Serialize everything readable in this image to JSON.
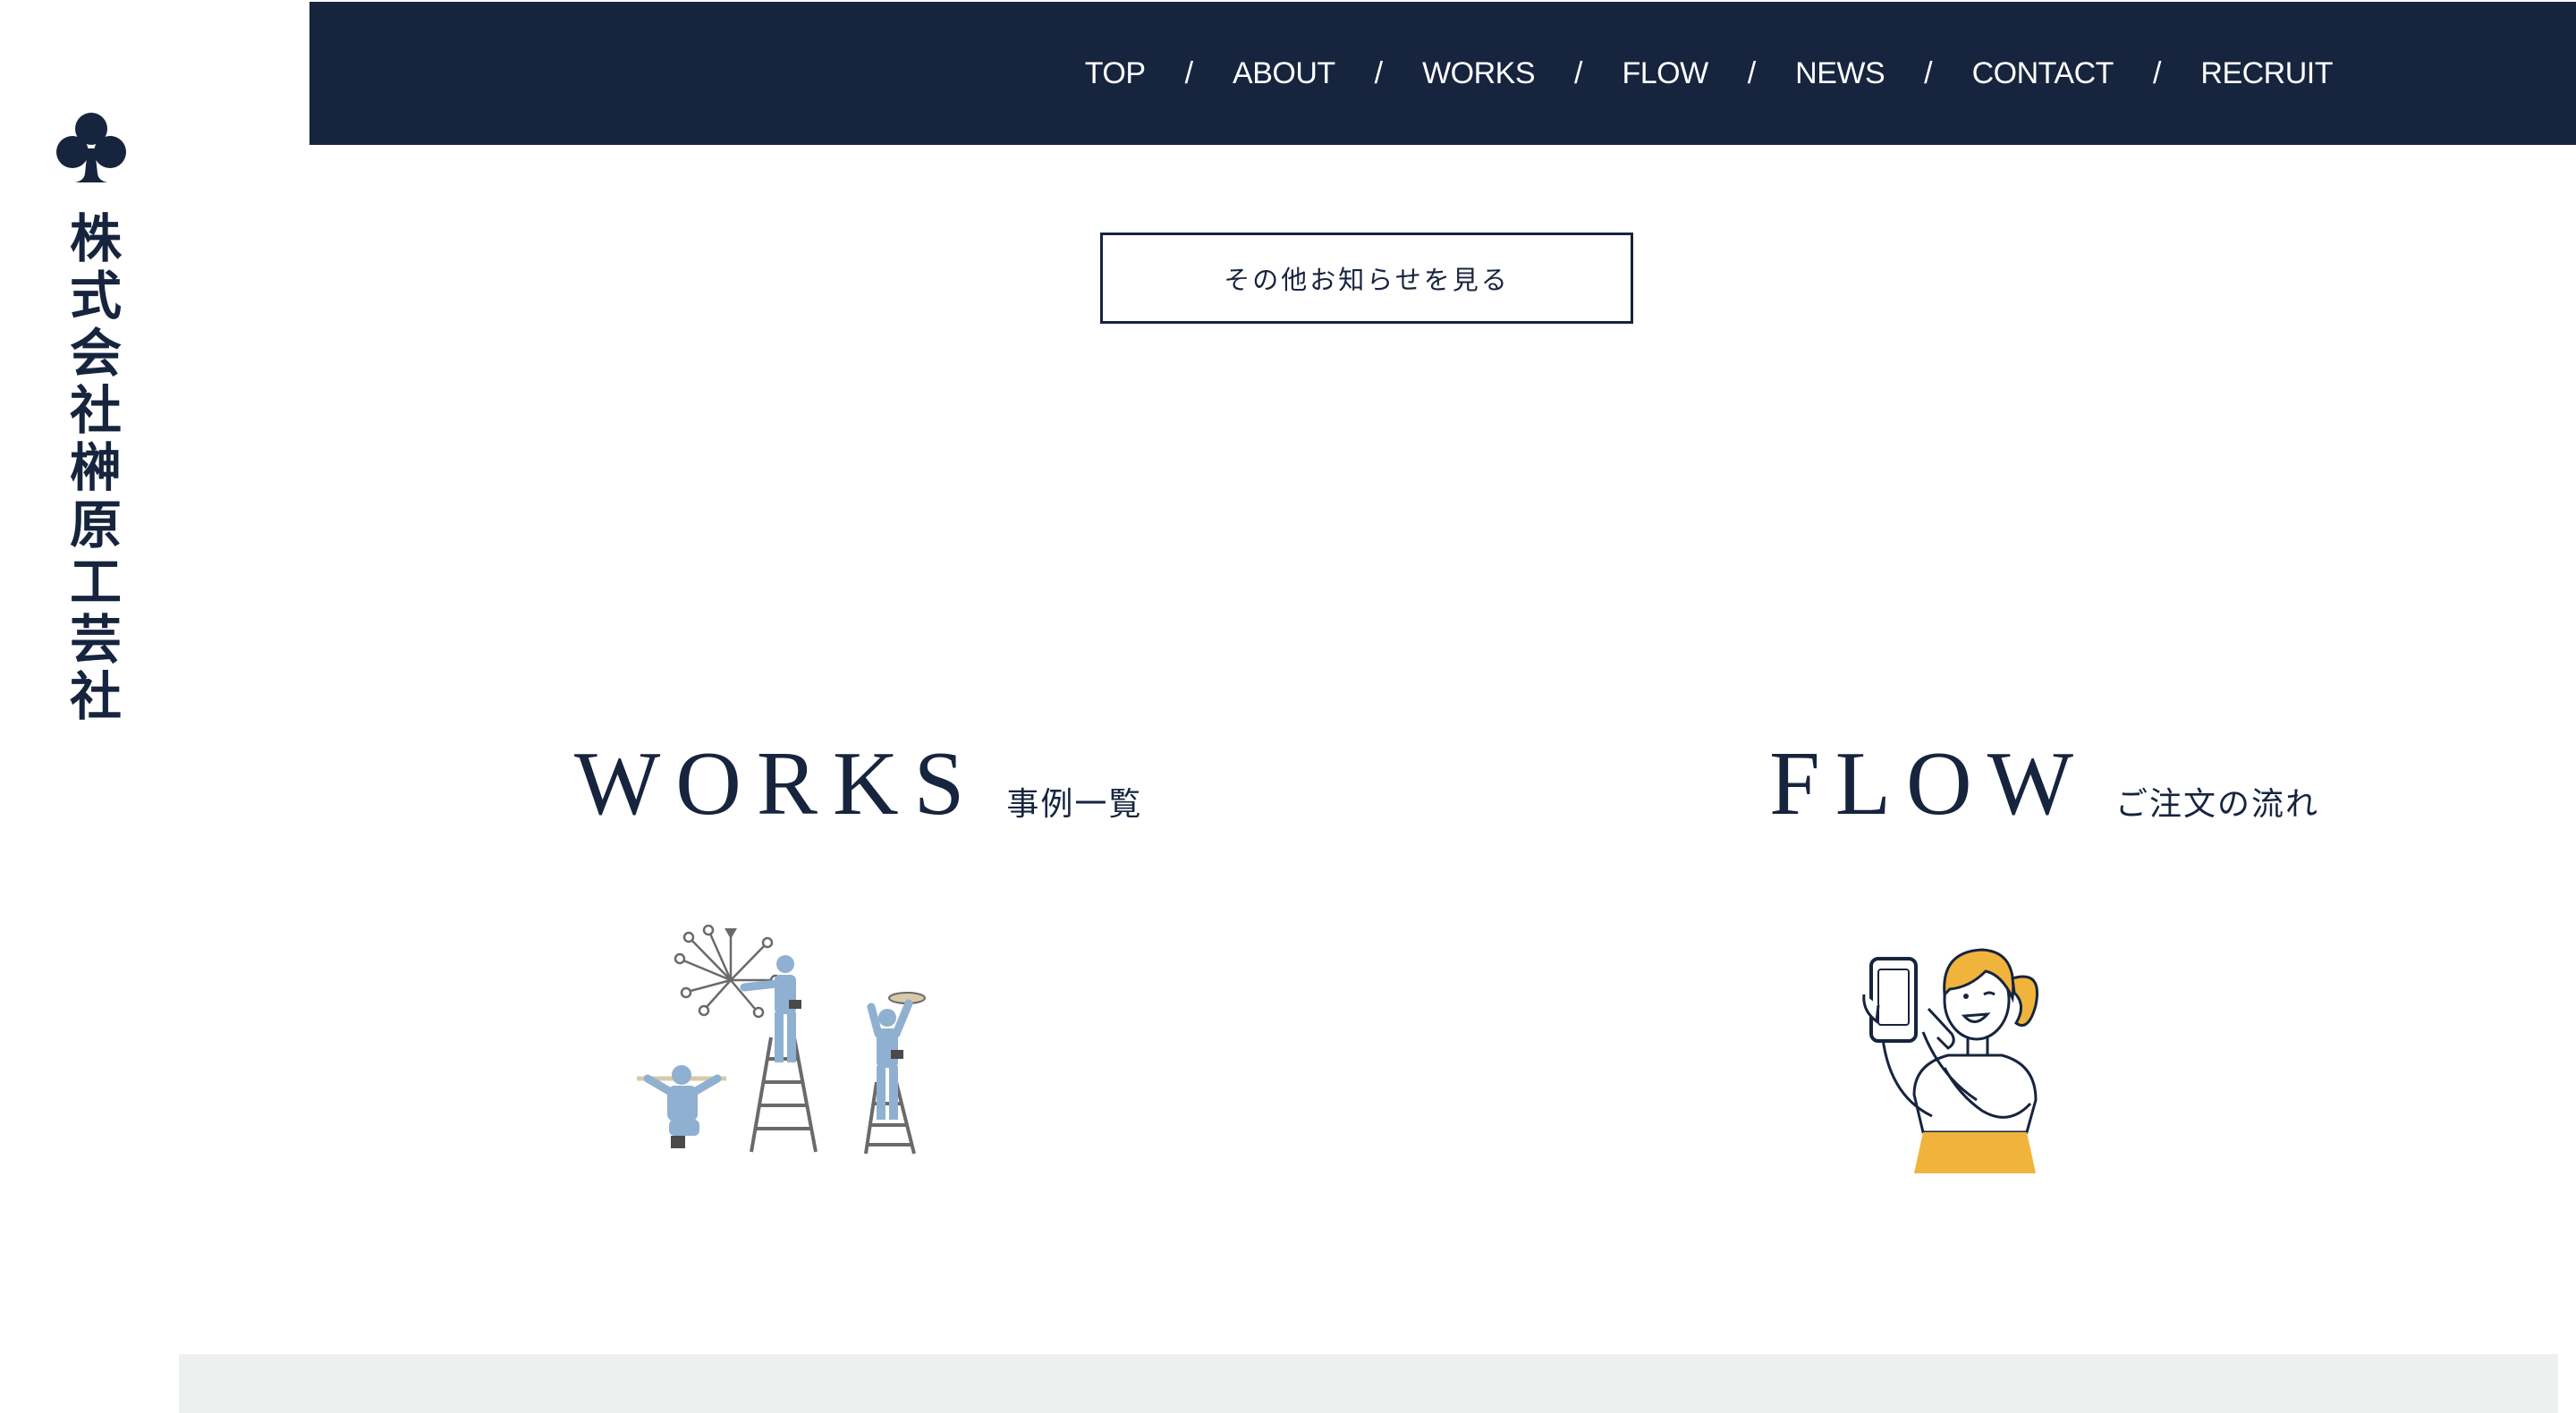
{
  "logo": {
    "company_name": "株式会社榊原工芸社",
    "mark_icon": "club-suit-icon"
  },
  "nav": {
    "items": [
      {
        "label": "TOP"
      },
      {
        "label": "ABOUT"
      },
      {
        "label": "WORKS"
      },
      {
        "label": "FLOW"
      },
      {
        "label": "NEWS"
      },
      {
        "label": "CONTACT"
      },
      {
        "label": "RECRUIT"
      }
    ],
    "separator": "/"
  },
  "news": {
    "more_button_label": "その他お知らせを見る"
  },
  "works": {
    "title": "WORKS",
    "subtitle": "事例一覧",
    "illustration_icon": "workers-installing-chandelier-illustration"
  },
  "flow": {
    "title": "FLOW",
    "subtitle": "ご注文の流れ",
    "illustration_icon": "woman-holding-smartphone-illustration"
  },
  "colors": {
    "navy": "#16243e",
    "white": "#ffffff",
    "band_gray": "#eef0ef",
    "worker_blue": "#8fb0d1",
    "hair_orange": "#f0b43c"
  }
}
